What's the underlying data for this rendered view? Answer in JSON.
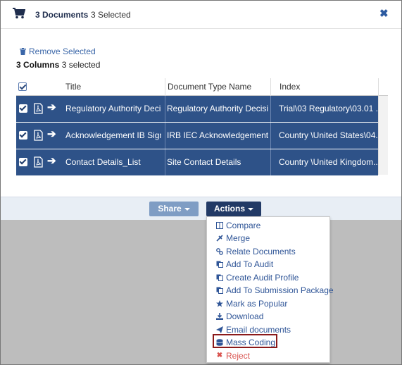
{
  "header": {
    "count_label": "3 Documents",
    "selected_label": "3 Selected",
    "close_glyph": "✖"
  },
  "toolbar": {
    "remove_label": "Remove Selected",
    "columns_label": "3 Columns",
    "columns_selected": "3 selected"
  },
  "grid": {
    "columns": [
      "Title",
      "Document Type Name",
      "Index"
    ],
    "rows": [
      {
        "title": "Regulatory Authority Deci...",
        "type": "Regulatory Authority Decisi...",
        "index": "Trial\\03 Regulatory\\03.01 ..."
      },
      {
        "title": "Acknowledgement IB Sign...",
        "type": "IRB IEC Acknowledgement ...",
        "index": "Country \\United States\\04..."
      },
      {
        "title": "Contact Details_List",
        "type": "Site Contact Details",
        "index": "Country \\United Kingdom..."
      }
    ]
  },
  "footer": {
    "share_label": "Share",
    "actions_label": "Actions"
  },
  "menu": {
    "items": [
      {
        "label": "Compare",
        "icon": "compare-icon"
      },
      {
        "label": "Merge",
        "icon": "merge-icon"
      },
      {
        "label": "Relate Documents",
        "icon": "link-icon"
      },
      {
        "label": "Add To Audit",
        "icon": "copy-icon"
      },
      {
        "label": "Create Audit Profile",
        "icon": "copy-icon"
      },
      {
        "label": "Add To Submission Package",
        "icon": "copy-icon"
      },
      {
        "label": "Mark as Popular",
        "icon": "star-icon"
      },
      {
        "label": "Download",
        "icon": "download-icon"
      },
      {
        "label": "Email documents",
        "icon": "send-icon"
      },
      {
        "label": "Mass Coding",
        "icon": "database-icon"
      },
      {
        "label": "Reject",
        "icon": "x-icon"
      }
    ]
  },
  "colors": {
    "row_selected": "#2e5288",
    "accent": "#2f5597",
    "highlight_border": "#8b1a1a",
    "reject": "#d9534f"
  }
}
